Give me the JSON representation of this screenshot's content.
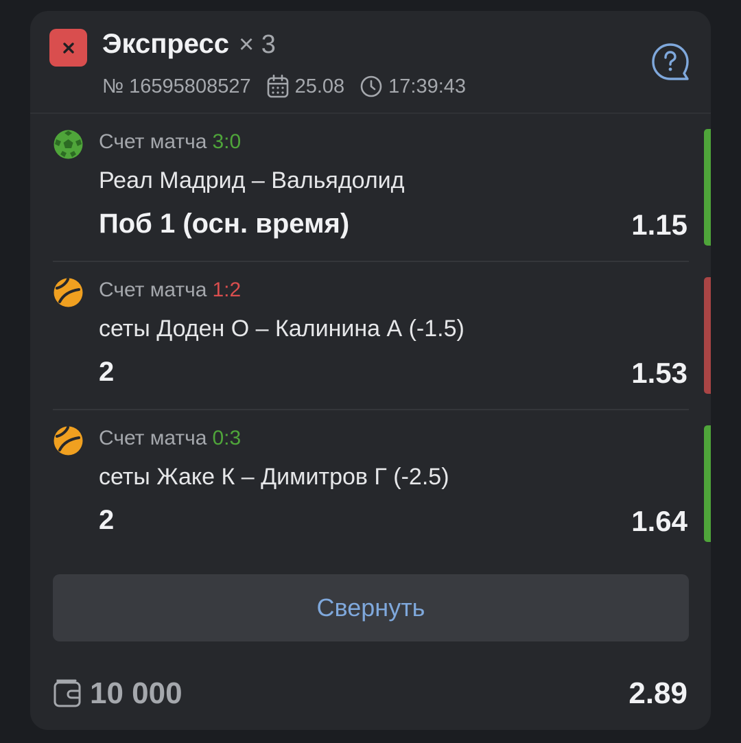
{
  "colors": {
    "card_bg": "#26282c",
    "lost_red": "#d94e4e",
    "won_green": "#4fa53a",
    "accent_blue": "#7fa8dc",
    "muted_text": "#a5a8ad",
    "tennis_orange": "#f0a020"
  },
  "header": {
    "status_icon": "close-icon",
    "title": "Экспресс",
    "multiplier": "× 3",
    "bet_number": "№ 16595808527",
    "date": "25.08",
    "time": "17:39:43",
    "help_icon": "question-bubble-icon"
  },
  "events": [
    {
      "sport_icon": "football-icon",
      "score_label": "Счет матча",
      "score": "3:0",
      "score_color": "#4fa53a",
      "match": "Реал Мадрид – Вальядолид",
      "bet": "Поб 1 (осн. время)",
      "odd": "1.15",
      "result": "won"
    },
    {
      "sport_icon": "tennis-icon",
      "score_label": "Счет матча",
      "score": "1:2",
      "score_color": "#d94e4e",
      "match": "сеты Доден О – Калинина А (-1.5)",
      "bet": "2",
      "odd": "1.53",
      "result": "lost"
    },
    {
      "sport_icon": "tennis-icon",
      "score_label": "Счет матча",
      "score": "0:3",
      "score_color": "#4fa53a",
      "match": "сеты Жаке К – Димитров Г (-2.5)",
      "bet": "2",
      "odd": "1.64",
      "result": "won"
    }
  ],
  "collapse_label": "Свернуть",
  "footer": {
    "wallet_icon": "wallet-icon",
    "stake": "10 000",
    "total_odd": "2.89"
  }
}
